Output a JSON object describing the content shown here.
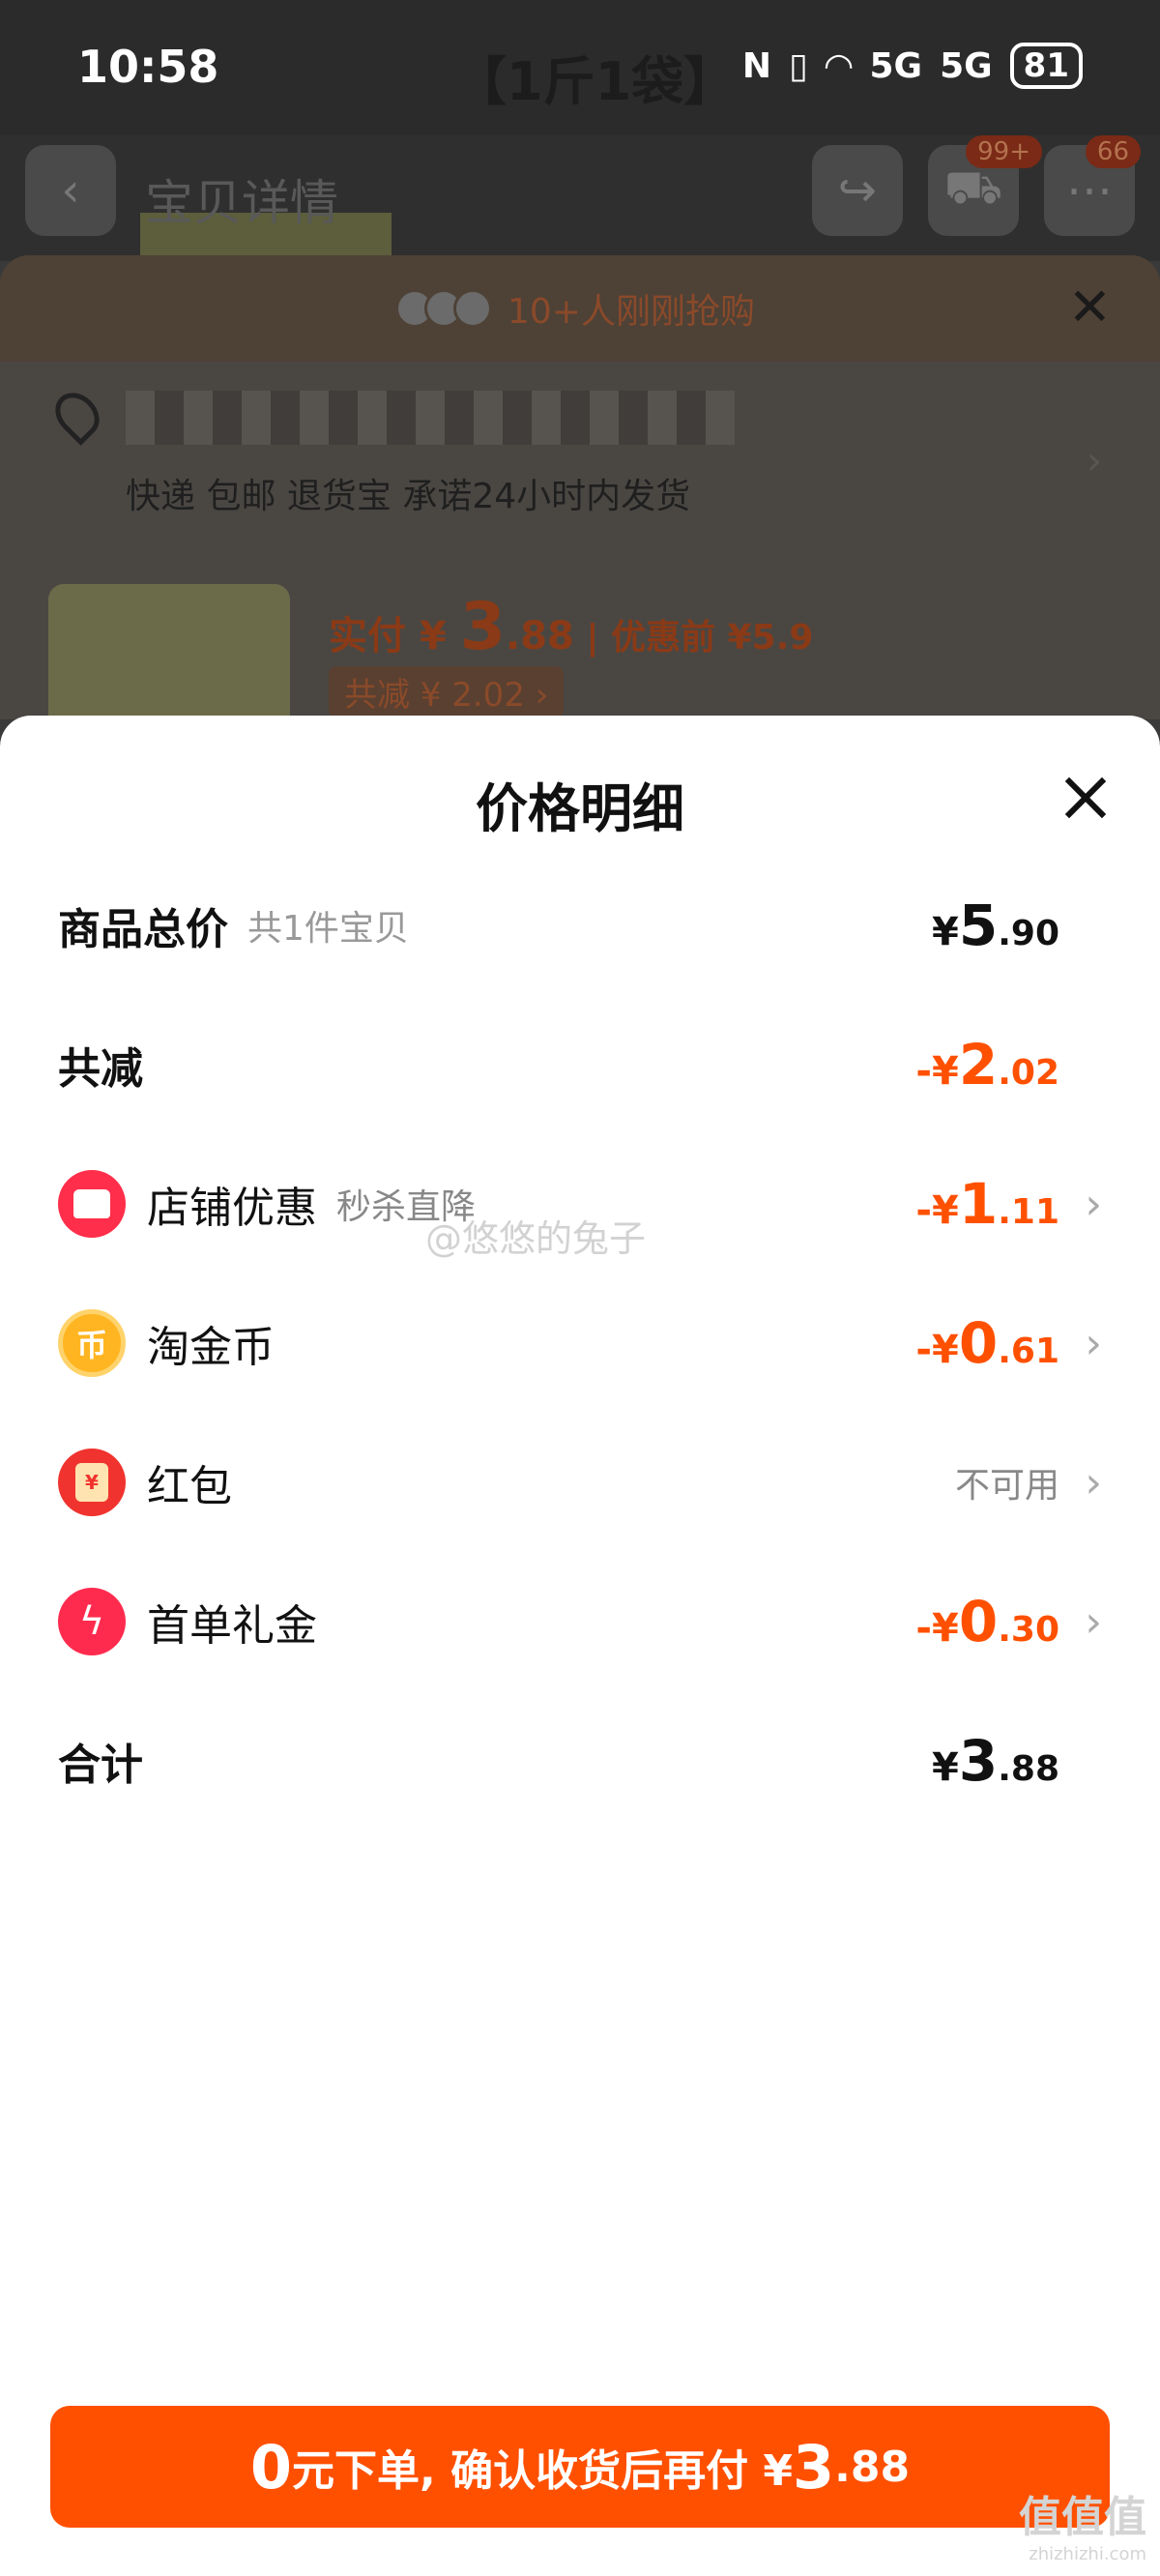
{
  "status_bar": {
    "time": "10:58",
    "title_overlay": "【1斤1袋】",
    "signal_1": "5G",
    "signal_2": "5G",
    "battery": "81"
  },
  "nav": {
    "back_label": "宝贝详情",
    "cart_badge": "99+",
    "more_badge": "66"
  },
  "background_sheet": {
    "rush_text": "10+人刚刚抢购",
    "address_line2": "快递 包邮 退货宝 承诺24小时内发货",
    "product_thumb_label": "【1斤1袋】",
    "pay_label": "实付 ¥ ",
    "pay_int": "3",
    "pay_dec": ".88",
    "before_label": " | 优惠前 ¥5.9",
    "discount_chip": "共减 ¥ 2.02 ›"
  },
  "sheet": {
    "title": "价格明细",
    "rows": {
      "total": {
        "label": "商品总价",
        "sub": "共1件宝贝",
        "cur": "¥",
        "int": "5",
        "dec": ".90"
      },
      "reduce": {
        "label": "共减",
        "cur": "-¥",
        "int": "2",
        "dec": ".02"
      },
      "store": {
        "label": "店铺优惠",
        "sub": "秒杀直降",
        "cur": "-¥",
        "int": "1",
        "dec": ".11"
      },
      "coin": {
        "label": "淘金币",
        "cur": "-¥",
        "int": "0",
        "dec": ".61"
      },
      "redpack": {
        "label": "红包",
        "value": "不可用"
      },
      "first": {
        "label": "首单礼金",
        "cur": "-¥",
        "int": "0",
        "dec": ".30"
      },
      "sum": {
        "label": "合计",
        "cur": "¥",
        "int": "3",
        "dec": ".88"
      }
    },
    "watermark": "@悠悠的兔子"
  },
  "cta": {
    "int": "0",
    "text": "元下单, 确认收货后再付 ¥",
    "pay_int": "3",
    "pay_dec": ".88"
  },
  "corner_mark": {
    "main": "值值值",
    "sub": "zhizhizhi.com"
  },
  "colors": {
    "accent": "#ff5000",
    "overlay": "#3a3a3a"
  }
}
